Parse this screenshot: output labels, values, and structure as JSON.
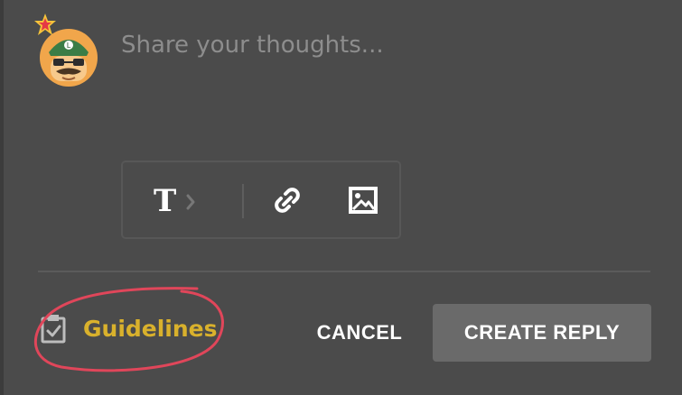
{
  "composer": {
    "placeholder": "Share your thoughts..."
  },
  "toolbar": {
    "text_icon": "T",
    "chevron_icon": "chevron-right-icon",
    "link_icon": "link-icon",
    "image_icon": "image-icon"
  },
  "footer": {
    "guidelines_label": "Guidelines",
    "guidelines_icon": "clipboard-check-icon",
    "cancel_label": "CANCEL",
    "create_reply_label": "CREATE REPLY"
  },
  "colors": {
    "background": "#4b4b4b",
    "guidelines": "#d9b12c",
    "annotation": "#e0465a",
    "button": "#6a6a6a"
  }
}
